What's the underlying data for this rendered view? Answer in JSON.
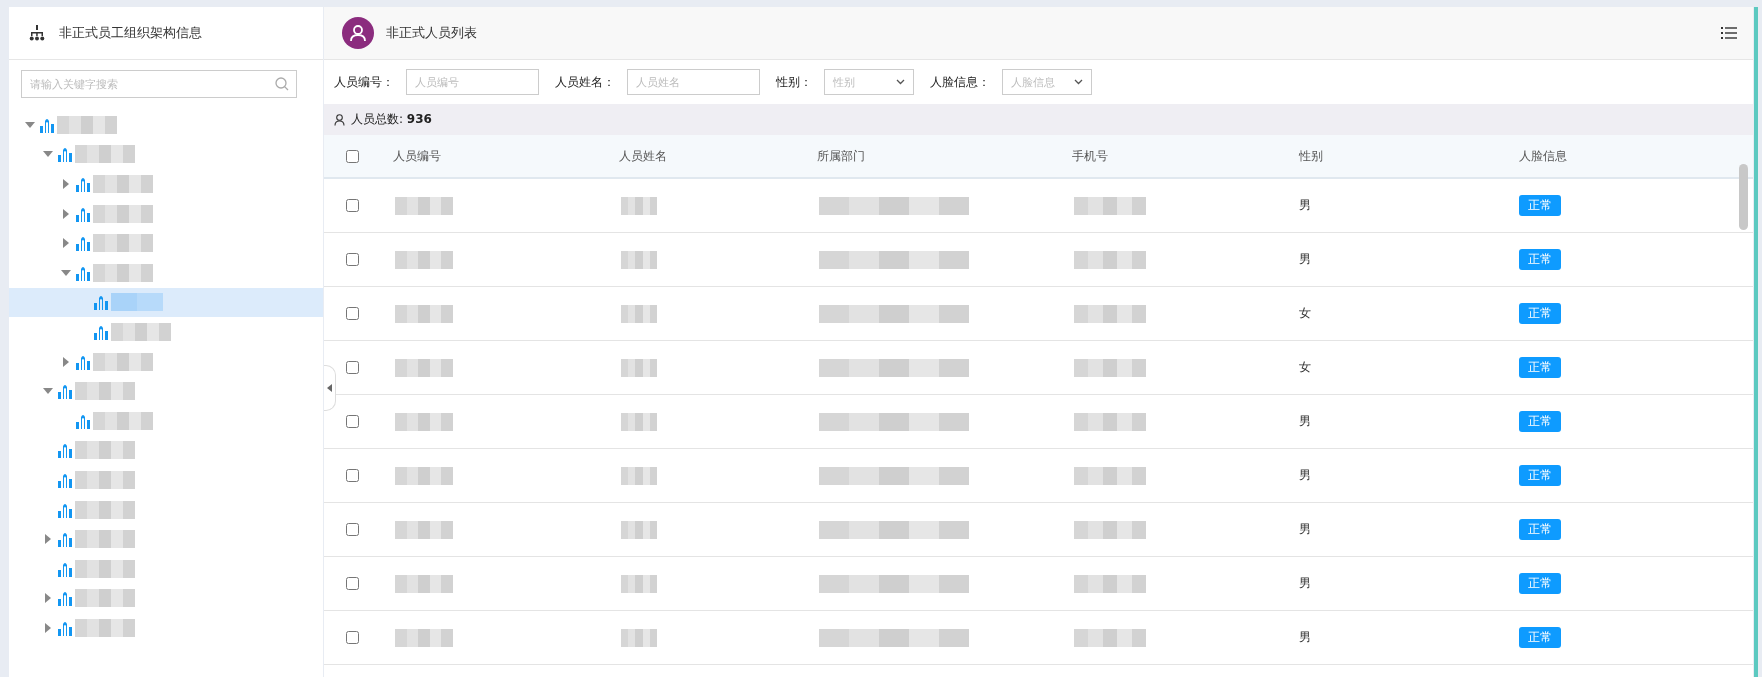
{
  "sidebar": {
    "title": "非正式员工组织架构信息",
    "search": {
      "placeholder": "请输入关键字搜索"
    },
    "tree": [
      {
        "kind": "branch",
        "expanded": true,
        "selected": false,
        "children": [
          {
            "kind": "branch",
            "expanded": true,
            "selected": false,
            "children": [
              {
                "kind": "branch",
                "expanded": false,
                "selected": false
              },
              {
                "kind": "branch",
                "expanded": false,
                "selected": false
              },
              {
                "kind": "branch",
                "expanded": false,
                "selected": false
              },
              {
                "kind": "branch",
                "expanded": true,
                "selected": false,
                "children": [
                  {
                    "kind": "leaf",
                    "selected": true
                  },
                  {
                    "kind": "leaf",
                    "selected": false
                  }
                ]
              },
              {
                "kind": "branch",
                "expanded": false,
                "selected": false
              }
            ]
          },
          {
            "kind": "branch",
            "expanded": true,
            "selected": false,
            "children": [
              {
                "kind": "leaf",
                "selected": false
              }
            ]
          },
          {
            "kind": "leaf",
            "selected": false
          },
          {
            "kind": "leaf",
            "selected": false
          },
          {
            "kind": "leaf",
            "selected": false
          },
          {
            "kind": "branch",
            "expanded": false,
            "selected": false
          },
          {
            "kind": "leaf",
            "selected": false
          },
          {
            "kind": "branch",
            "expanded": false,
            "selected": false
          },
          {
            "kind": "branch",
            "expanded": false,
            "selected": false
          }
        ]
      }
    ]
  },
  "main": {
    "title": "非正式人员列表",
    "filters": [
      {
        "label": "人员编号：",
        "kind": "input",
        "placeholder": "人员编号"
      },
      {
        "label": "人员姓名：",
        "kind": "input",
        "placeholder": "人员姓名"
      },
      {
        "label": "性别：",
        "kind": "select",
        "placeholder": "性别"
      },
      {
        "label": "人脸信息：",
        "kind": "select",
        "placeholder": "人脸信息"
      }
    ],
    "summary": "人员总数: **936**",
    "table": {
      "header_checked": false,
      "columns": [
        "人员编号",
        "人员姓名",
        "所属部门",
        "手机号",
        "性别",
        "人脸信息"
      ],
      "rows": [
        {
          "checked": false,
          "gender": "男",
          "face": "正常"
        },
        {
          "checked": false,
          "gender": "男",
          "face": "正常"
        },
        {
          "checked": false,
          "gender": "女",
          "face": "正常"
        },
        {
          "checked": false,
          "gender": "女",
          "face": "正常"
        },
        {
          "checked": false,
          "gender": "男",
          "face": "正常"
        },
        {
          "checked": false,
          "gender": "男",
          "face": "正常"
        },
        {
          "checked": false,
          "gender": "男",
          "face": "正常"
        },
        {
          "checked": false,
          "gender": "男",
          "face": "正常"
        },
        {
          "checked": false,
          "gender": "男",
          "face": "正常"
        }
      ]
    }
  }
}
